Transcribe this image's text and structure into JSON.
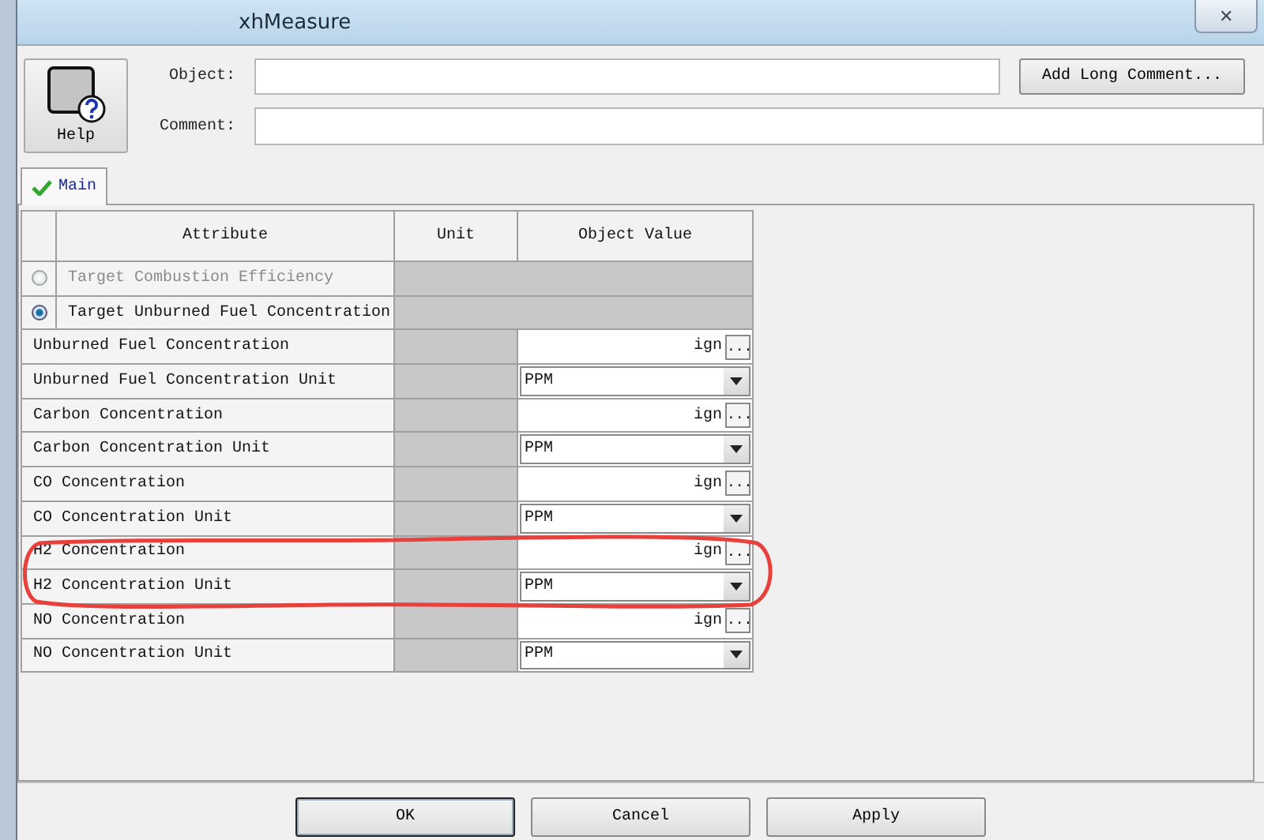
{
  "window": {
    "title": "xhMeasure",
    "close": "✕"
  },
  "help_button": {
    "label": "Help"
  },
  "object_field": {
    "label": "Object:"
  },
  "comment_field": {
    "label": "Comment:"
  },
  "add_long_comment_button": {
    "label": "Add Long Comment..."
  },
  "tabs": [
    {
      "label": "Main",
      "selected": true
    }
  ],
  "table": {
    "columns": [
      "Attribute",
      "Unit",
      "Object Value"
    ],
    "rows": [
      {
        "kind": "radio",
        "label": "Target Combustion Efficiency",
        "selected": false
      },
      {
        "kind": "radio",
        "label": "Target Unburned Fuel Concentration",
        "selected": true
      },
      {
        "kind": "value",
        "label": "Unburned Fuel Concentration",
        "value": "ign",
        "button": "..."
      },
      {
        "kind": "dropdown",
        "label": "Unburned Fuel Concentration Unit",
        "value": "PPM"
      },
      {
        "kind": "value",
        "label": "Carbon Concentration",
        "value": "ign",
        "button": "..."
      },
      {
        "kind": "dropdown",
        "label": "Carbon Concentration Unit",
        "value": "PPM"
      },
      {
        "kind": "value",
        "label": "CO Concentration",
        "value": "ign",
        "button": "..."
      },
      {
        "kind": "dropdown",
        "label": "CO Concentration Unit",
        "value": "PPM"
      },
      {
        "kind": "value",
        "label": "H2 Concentration",
        "value": "ign",
        "button": "..."
      },
      {
        "kind": "dropdown",
        "label": "H2 Concentration Unit",
        "value": "PPM"
      },
      {
        "kind": "value",
        "label": "NO Concentration",
        "value": "ign",
        "button": "..."
      },
      {
        "kind": "dropdown",
        "label": "NO Concentration Unit",
        "value": "PPM"
      }
    ]
  },
  "highlight": {
    "kind": "ellipse"
  },
  "buttons": [
    {
      "label": "OK",
      "default": true
    },
    {
      "label": "Cancel",
      "default": false
    },
    {
      "label": "Apply",
      "default": false
    }
  ]
}
